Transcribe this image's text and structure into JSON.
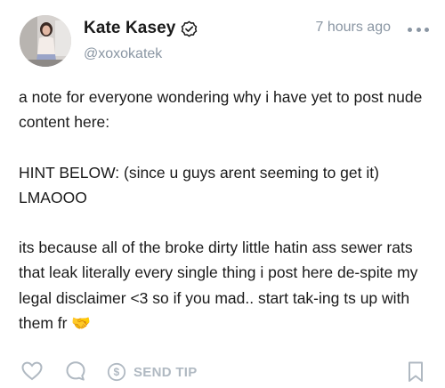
{
  "post": {
    "author_name": "Kate Kasey",
    "handle": "@xoxokatek",
    "time_ago": "7 hours ago",
    "text": "a note for everyone wondering why i have yet to post nude content here:\n\nHINT BELOW: (since u guys arent seeming to get it) LMAOOO\n\nits because all of the broke dirty little hatin ass sewer rats that leak literally every single thing i post here de-spite my legal disclaimer <3 so if you mad.. start tak-ing ts up with them fr 🤝"
  },
  "actions": {
    "send_tip_label": "SEND TIP"
  },
  "icons": {
    "verified": "verified-badge-icon",
    "more": "more-dots-icon",
    "like": "heart-icon",
    "comment": "comment-bubble-icon",
    "tip": "dollar-circle-icon",
    "bookmark": "bookmark-icon"
  },
  "colors": {
    "text": "#1a1a1a",
    "muted": "#8a96a3",
    "icon_light": "#b0b9c2"
  }
}
